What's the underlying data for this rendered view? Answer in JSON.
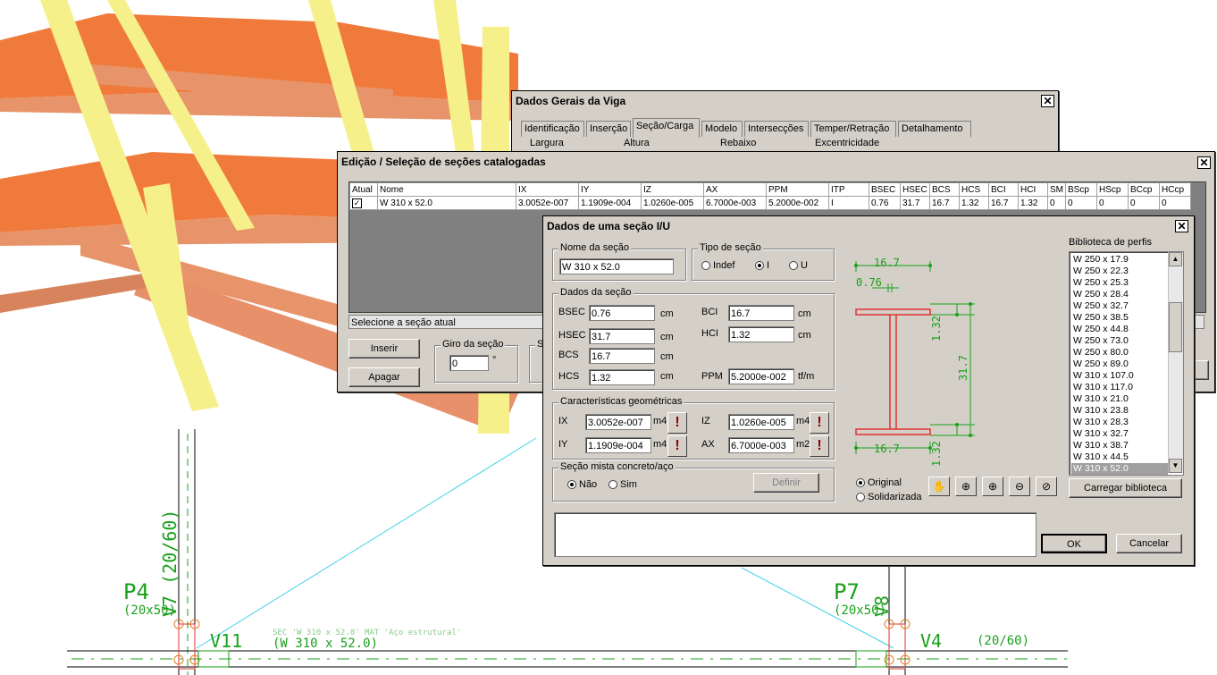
{
  "viga_window": {
    "title": "Dados Gerais da Viga",
    "tabs": [
      "Identificação",
      "Inserção",
      "Seção/Carga",
      "Modelo",
      "Intersecções",
      "Temper/Retração",
      "Detalhamento"
    ],
    "active_tab": "Seção/Carga",
    "fields": [
      "Largura",
      "Altura",
      "Rebaixo",
      "Excentricidade"
    ]
  },
  "edicao_window": {
    "title": "Edição / Seleção de seções catalogadas",
    "columns": [
      "Atual",
      "Nome",
      "IX",
      "IY",
      "IZ",
      "AX",
      "PPM",
      "ITP",
      "BSEC",
      "HSEC",
      "BCS",
      "HCS",
      "BCI",
      "HCI",
      "SM",
      "BScp",
      "HScp",
      "BCcp",
      "HCcp"
    ],
    "row": [
      "W 310 x 52.0",
      "3.0052e-007",
      "1.1909e-004",
      "1.0260e-005",
      "6.7000e-003",
      "5.2000e-002",
      "I",
      "0.76",
      "31.7",
      "16.7",
      "1.32",
      "16.7",
      "1.32",
      "0",
      "0",
      "0",
      "0",
      "0"
    ],
    "status": "Selecione a seção atual",
    "insert_label": "Inserir",
    "delete_label": "Apagar",
    "giro_legend": "Giro da seção",
    "giro_value": "0",
    "giro_unit": "°",
    "s_legend": "S"
  },
  "secao_dialog": {
    "title": "Dados de uma seção I/U",
    "nome_legend": "Nome da seção",
    "nome_value": "W 310 x 52.0",
    "tipo_legend": "Tipo de seção",
    "tipo_options": [
      "Indef",
      "I",
      "U"
    ],
    "tipo_selected": "I",
    "dados_legend": "Dados da seção",
    "bsec_label": "BSEC",
    "bsec_value": "0.76",
    "bsec_unit": "cm",
    "hsec_label": "HSEC",
    "hsec_value": "31.7",
    "hsec_unit": "cm",
    "bcs_label": "BCS",
    "bcs_value": "16.7",
    "bcs_unit": "cm",
    "hcs_label": "HCS",
    "hcs_value": "1.32",
    "hcs_unit": "cm",
    "bci_label": "BCI",
    "bci_value": "16.7",
    "bci_unit": "cm",
    "hci_label": "HCI",
    "hci_value": "1.32",
    "hci_unit": "cm",
    "ppm_label": "PPM",
    "ppm_value": "5.2000e-002",
    "ppm_unit": "tf/m",
    "geom_legend": "Características geométricas",
    "ix_label": "IX",
    "ix_value": "3.0052e-007",
    "ix_unit": "m4",
    "iy_label": "IY",
    "iy_value": "1.1909e-004",
    "iy_unit": "m4",
    "iz_label": "IZ",
    "iz_value": "1.0260e-005",
    "iz_unit": "m4",
    "ax_label": "AX",
    "ax_value": "6.7000e-003",
    "ax_unit": "m2",
    "mista_legend": "Seção mista concreto/aço",
    "mista_nao": "Não",
    "mista_sim": "Sim",
    "definir_label": "Definir",
    "drawing": {
      "top_width": "16.7",
      "web": "0.76",
      "height": "31.7",
      "flange_top": "1.32",
      "bottom_width": "16.7",
      "flange_bottom": "1.32"
    },
    "view_original": "Original",
    "view_solidarizada": "Solidarizada",
    "biblioteca_label": "Biblioteca de perfis",
    "biblioteca_items": [
      "W 250 x 17.9",
      "W 250 x 22.3",
      "W 250 x 25.3",
      "W 250 x 28.4",
      "W 250 x 32.7",
      "W 250 x 38.5",
      "W 250 x 44.8",
      "W 250 x 73.0",
      "W 250 x 80.0",
      "W 250 x 89.0",
      "W 310 x 107.0",
      "W 310 x 117.0",
      "W 310 x 21.0",
      "W 310 x 23.8",
      "W 310 x 28.3",
      "W 310 x 32.7",
      "W 310 x 38.7",
      "W 310 x 44.5",
      "W 310 x 52.0"
    ],
    "biblioteca_selected": "W 310 x 52.0",
    "carregar_label": "Carregar biblioteca",
    "ok_label": "OK",
    "cancel_label": "Cancelar"
  },
  "cad": {
    "p4": "P4",
    "p4_size": "(20x50)",
    "v7": "V7 (20/60)",
    "p7": "P7",
    "p7_size": "(20x50)",
    "v8": "V8",
    "v11": "V11",
    "v11_profile": "(W 310 x 52.0)",
    "sec_note": "SEC 'W 310 x 52.0' MAT 'Aço estrutural'",
    "v4": "V4",
    "v4_size": "(20/60)"
  },
  "colors": {
    "beam_orange": "#f07a3c",
    "column_yellow": "#f5f08a",
    "cad_green": "#1aa01a",
    "cad_cyan": "#3fd3e6"
  }
}
